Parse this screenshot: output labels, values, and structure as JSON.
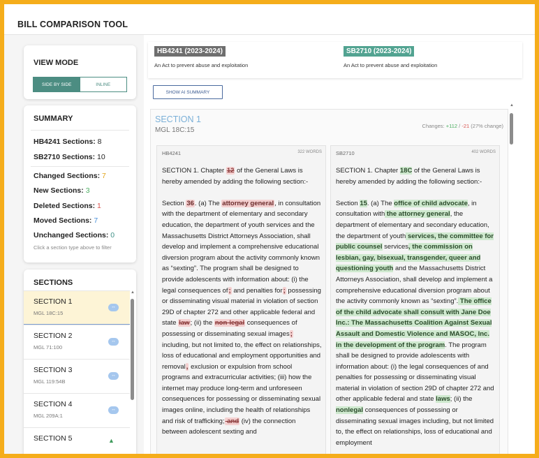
{
  "app_title": "BILL COMPARISON TOOL",
  "view_mode": {
    "title": "VIEW MODE",
    "options": [
      "SIDE BY SIDE",
      "INLINE"
    ],
    "selected": "SIDE BY SIDE"
  },
  "summary": {
    "title": "SUMMARY",
    "hb_label": "HB4241 Sections:",
    "hb_value": "8",
    "sb_label": "SB2710 Sections:",
    "sb_value": "10",
    "changed_label": "Changed Sections:",
    "changed_value": "7",
    "new_label": "New Sections:",
    "new_value": "3",
    "deleted_label": "Deleted Sections:",
    "deleted_value": "1",
    "moved_label": "Moved Sections:",
    "moved_value": "7",
    "unchanged_label": "Unchanged Sections:",
    "unchanged_value": "0",
    "hint": "Click a section type above to filter"
  },
  "sections_panel": {
    "title": "SECTIONS",
    "items": [
      {
        "name": "SECTION 1",
        "sub": "MGL 18C:15",
        "icon": "diff-icon",
        "pill": "↔"
      },
      {
        "name": "SECTION 2",
        "sub": "MGL 71:100",
        "icon": "diff-icon",
        "pill": "↔"
      },
      {
        "name": "SECTION 3",
        "sub": "MGL 119:54B",
        "icon": "diff-icon",
        "pill": "↔"
      },
      {
        "name": "SECTION 4",
        "sub": "MGL 209A:1",
        "icon": "diff-icon",
        "pill": "↔"
      },
      {
        "name": "SECTION 5",
        "sub": "",
        "icon": "arrow-up-icon",
        "pill": "▲"
      }
    ]
  },
  "bills": {
    "left": {
      "id": "HB4241 (2023-2024)",
      "title": "An Act to prevent abuse and exploitation"
    },
    "right": {
      "id": "SB2710 (2023-2024)",
      "title": "An Act to prevent abuse and exploitation"
    }
  },
  "ai_button": "SHOW AI SUMMARY",
  "section": {
    "title": "SECTION 1",
    "subtitle": "MGL 18C:15",
    "changes_label": "Changes:",
    "plus": "+112",
    "sep": "/",
    "minus": "-21",
    "pct": "(27% change)"
  },
  "left_pane": {
    "head": "HB4241",
    "words": "322 WORDS",
    "p1a": "SECTION 1. Chapter ",
    "p1del": "12",
    "p1b": " of the General Laws is hereby amended by adding the following section:-",
    "p2a": "Section ",
    "p2h1": "36",
    "p2b": ". (a) The ",
    "p2h2": "attorney general",
    "p2c": ", in consultation with the department of elementary and secondary education, the department of youth services and the Massachusetts District Attorneys Association, shall develop and implement a comprehensive educational diversion program about the activity commonly known as “sexting”. The program shall be designed to provide adolescents with information about: (i) the legal consequences of",
    "p2h3": ";",
    "p2d": " and penalties for",
    "p2h4": ";",
    "p2e": " possessing or disseminating visual material in violation of section 29D of chapter 272 and other applicable federal and state ",
    "p2h5": "law",
    "p2f": "; (ii) the ",
    "p2h6": "non-legal",
    "p2g": " consequences of possessing or disseminating sexual images",
    "p2h7": ";",
    "p2h": " including, but not limited to, the effect on relationships, loss of educational and employment opportunities and removal",
    "p2h8": ",",
    "p2i": " exclusion or expulsion from school programs and extracurricular activities; (iii) how the internet may produce long-term and unforeseen consequences for possessing or disseminating sexual images online, including the health of relationships and risk of trafficking;",
    "p2h9": " and",
    "p2j": " (iv) the connection between adolescent sexting and"
  },
  "right_pane": {
    "head": "SB2710",
    "words": "402 WORDS",
    "p1a": "SECTION 1. Chapter ",
    "p1g": "18C",
    "p1b": " of the General Laws is hereby amended by adding the following section:-",
    "p2a": "Section ",
    "p2g1": "15",
    "p2b": ". (a) The ",
    "p2g2": "office of child advocate",
    "p2c": ", in consultation with",
    "p2g3": " the attorney general",
    "p2d": ", the department of elementary and secondary education, the department of youth",
    "p2g4": " services, the committee for public counsel",
    "p2e": " services",
    "p2g5": ", the commission on lesbian, gay, bisexual, transgender, queer and questioning youth",
    "p2f": " and the Massachusetts District Attorneys Association, shall develop and implement a comprehensive educational diversion program about the activity commonly known as “sexting”.",
    "p2g6": " The office of the child advocate shall consult with Jane Doe Inc.: The Massachusetts Coalition Against Sexual Assault and Domestic Violence and MASOC, Inc. in the development of the program",
    "p2g": ". The program shall be designed to provide adolescents with information about: (i) the legal consequences of and penalties for possessing or disseminating visual material in violation of section 29D of chapter 272 and other applicable federal and state ",
    "p2g7": "laws",
    "p2h": "; (ii) the ",
    "p2g8": "nonlegal",
    "p2i": " consequences of possessing or disseminating sexual images including, but not limited to, the effect on relationships, loss of educational and employment"
  }
}
